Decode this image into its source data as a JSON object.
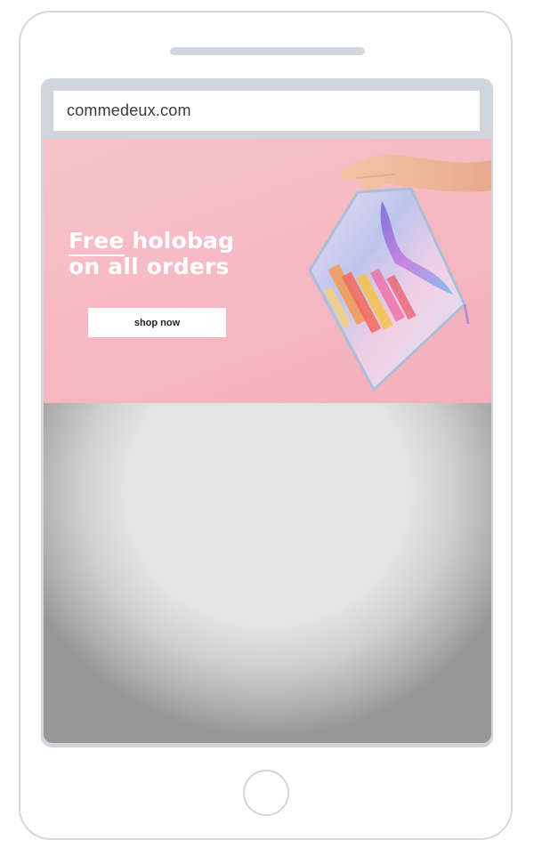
{
  "browser": {
    "url": "commedeux.com"
  },
  "hero": {
    "headline_line1_prefix": "Free",
    "headline_line1_rest": " holobag",
    "headline_line2": "on all orders",
    "cta_label": "shop now"
  },
  "colors": {
    "hero_pink": "#f5b8c2",
    "device_outline": "#d3d9de",
    "button_bg": "#ffffff"
  },
  "icons": {
    "home_button": "home-button-icon",
    "speaker": "speaker-slot"
  }
}
